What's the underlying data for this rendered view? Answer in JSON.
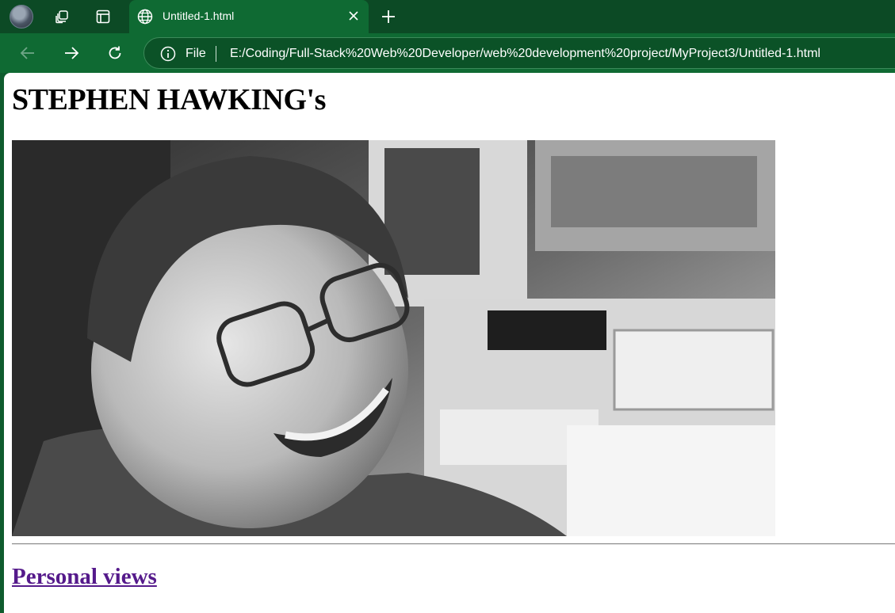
{
  "browser": {
    "tab": {
      "title": "Untitled-1.html",
      "icon": "globe-icon"
    },
    "address": {
      "scheme_label": "File",
      "url": "E:/Coding/Full-Stack%20Web%20Developer/web%20development%20project/MyProject3/Untitled-1.html"
    },
    "colors": {
      "frame": "#0c4a25",
      "toolbar": "#0f6a33",
      "accent": "#0f5c2e"
    }
  },
  "page": {
    "heading": "STEPHEN HAWKING's",
    "image": {
      "subject": "black-and-white photo of Stephen Hawking smiling at a desk"
    },
    "link": {
      "label": "Personal views",
      "color": "#551a8b"
    }
  }
}
